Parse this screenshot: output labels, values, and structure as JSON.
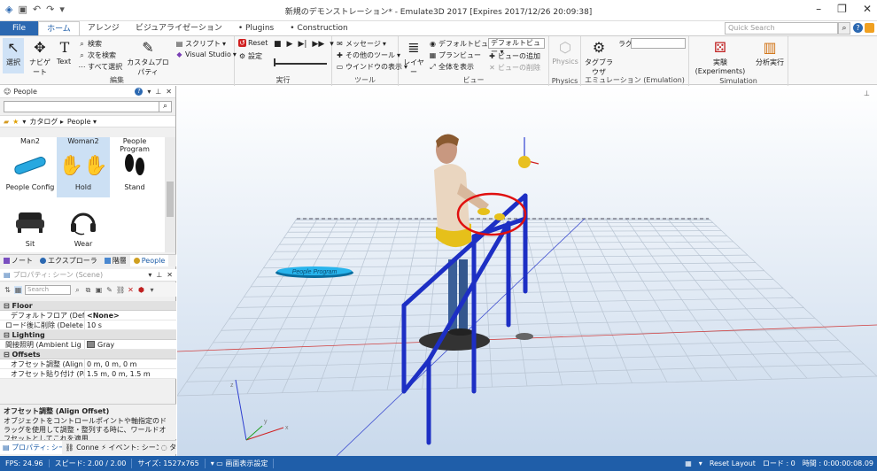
{
  "titlebar": {
    "title": "新規のデモンストレーション* - Emulate3D 2017 [Expires 2017/12/26 20:09:38]"
  },
  "tabs": [
    "File",
    "ホーム",
    "アレンジ",
    "ビジュアライゼーション",
    "Plugins",
    "Construction"
  ],
  "search": {
    "placeholder": "Quick Search"
  },
  "ribbon": {
    "edit": {
      "label": "編集",
      "select": "選択",
      "navigate": "ナビゲート",
      "text": "Text",
      "find": "検索",
      "find_next": "次を検索",
      "select_all": "すべて選択",
      "custom_property": "カスタムプロパティ",
      "script": "スクリプト",
      "visual_studio": "Visual Studio"
    },
    "run": {
      "label": "実行",
      "reset": "Reset",
      "settings": "設定"
    },
    "tools": {
      "label": "ツール",
      "message": "メッセージ",
      "other_tools": "その他のツール",
      "window_display": "ウインドウの表示"
    },
    "view": {
      "label": "ビュー",
      "layer": "レイヤー",
      "default_view": "デフォルトビュー",
      "default_view_select": "デフォルトビュー",
      "plan_view": "プランビュー",
      "show_all": "全体を表示",
      "add_view": "ビューの追加",
      "delete_view": "ビューの削除"
    },
    "physics": {
      "label": "Physics",
      "button": "Physics"
    },
    "emulation": {
      "label": "エミュレーション (Emulation)",
      "tag_browser": "タグブラウザ",
      "lag": "ラグ"
    },
    "simulation": {
      "label": "Simulation",
      "experiments": "実験 (Experiments)",
      "analysis_run": "分析実行"
    }
  },
  "people_panel": {
    "title": "People",
    "crumb_catalog": "カタログ",
    "crumb_people": "People",
    "items": [
      "Man2",
      "Woman2",
      "People Program",
      "People Config",
      "Hold",
      "Stand",
      "Sit",
      "Wear"
    ],
    "selected": "Hold"
  },
  "panel_tabs": [
    "ノート",
    "エクスプローラ",
    "階層",
    "People"
  ],
  "properties": {
    "title": "プロパティ: シーン (Scene)",
    "search_placeholder": "Search",
    "categories": [
      {
        "name": "Floor",
        "rows": [
          {
            "key": "デフォルトフロア (Default",
            "value": "<None>"
          },
          {
            "key": "ロード後に削除 (Delete",
            "value": "10 s"
          }
        ]
      },
      {
        "name": "Lighting",
        "rows": [
          {
            "key": "間接照明 (Ambient Lig",
            "value": "Gray"
          }
        ]
      },
      {
        "name": "Offsets",
        "rows": [
          {
            "key": "オフセット調整 (Align O",
            "value": "0 m, 0 m, 0 m"
          },
          {
            "key": "オフセット貼り付け (Paste",
            "value": "1.5 m, 0 m, 1.5 m"
          }
        ]
      }
    ],
    "ambient_color": "#808080"
  },
  "description": {
    "title": "オフセット調整 (Align Offset)",
    "text": "オブジェクトをコントロールポイントや軸指定のドラッグを使用して調整・整列する時に、ワールドオフセットとしてこれを適用"
  },
  "bottom_tabs": [
    "プロパティ: シーン",
    "Connec",
    "イベント: シーン (",
    "タ"
  ],
  "viewport": {
    "program_label": "People Program"
  },
  "status": {
    "fps": "FPS: 24.96",
    "speed": "スピード: 2.00 / 2.00",
    "size": "サイズ: 1527x765",
    "display_settings": "画面表示設定",
    "reset_layout": "Reset Layout",
    "load": "ロード : 0",
    "time": "時間 : 0:00:00:08.09"
  },
  "colors": {
    "accent": "#2b68b1",
    "status_bar": "#1f5ea9",
    "rail": "#1d2fc4",
    "highlight_circle": "#e01010"
  }
}
